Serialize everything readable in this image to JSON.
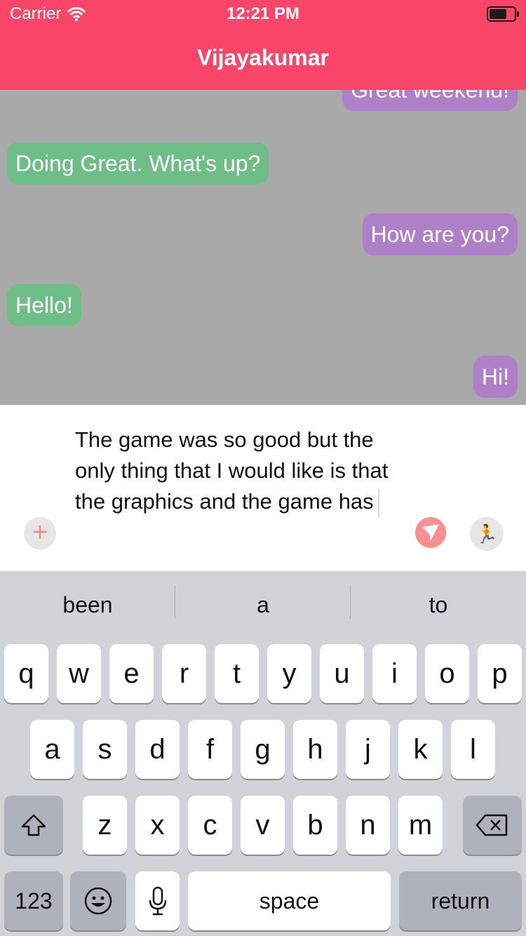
{
  "status_bar": {
    "carrier": "Carrier",
    "time": "12:21 PM",
    "icons": [
      "wifi-icon",
      "battery-icon"
    ]
  },
  "header": {
    "title": "Vijayakumar"
  },
  "chat": {
    "messages": [
      {
        "text": "Great weekend!",
        "side": "outgoing"
      },
      {
        "text": "Doing Great. What's up?",
        "side": "incoming"
      },
      {
        "text": "How are you?",
        "side": "outgoing"
      },
      {
        "text": "Hello!",
        "side": "incoming"
      },
      {
        "text": "Hi!",
        "side": "outgoing"
      }
    ]
  },
  "composer": {
    "text": "The game was so good but the only thing that I would like is that the graphics and the game has",
    "add_icon": "plus-icon",
    "send_icon": "send-icon",
    "extra_icon": "walking-person-icon"
  },
  "keyboard": {
    "suggestions": [
      "been",
      "a",
      "to"
    ],
    "row1": [
      "q",
      "w",
      "e",
      "r",
      "t",
      "y",
      "u",
      "i",
      "o",
      "p"
    ],
    "row2": [
      "a",
      "s",
      "d",
      "f",
      "g",
      "h",
      "j",
      "k",
      "l"
    ],
    "row3": [
      "z",
      "x",
      "c",
      "v",
      "b",
      "n",
      "m"
    ],
    "numbers_label": "123",
    "space_label": "space",
    "return_label": "return",
    "shift_icon": "shift-icon",
    "delete_icon": "backspace-icon",
    "emoji_icon": "emoji-icon",
    "mic_icon": "microphone-icon"
  },
  "colors": {
    "header": "#f94568",
    "chat_background": "#a9a9a9",
    "outgoing_bubble": "#ae80c8",
    "incoming_bubble": "#6ebe87",
    "keyboard_background": "#d1d3d9"
  }
}
